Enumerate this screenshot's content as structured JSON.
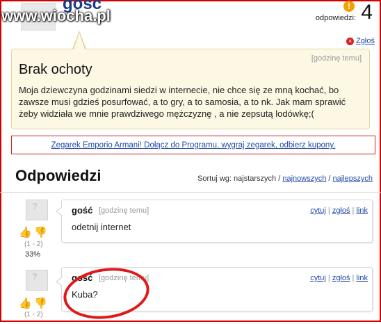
{
  "watermark": "www.wiocha.pl",
  "question": {
    "author": "gość",
    "answers_label": "odpowiedzi:",
    "answers_count": "4",
    "badge": "!",
    "report_label": "Zgłoś",
    "time": "[godzinę temu]",
    "title": "Brak ochoty",
    "body": "Moja dziewczyna godzinami siedzi w internecie, nie chce się ze mną kochać, bo zawsze musi gdzieś posurfować, a to gry, a to samosia, a to nk. Jak mam sprawić żeby widziała we mnie prawdziwego mężczyznę , a nie zepsutą lodówkę;("
  },
  "promo": {
    "text": "Zegarek Emporio Armani! Dołącz do Programu, wygraj zegarek, odbierz kupony."
  },
  "answers_section": {
    "title": "Odpowiedzi",
    "sort_label": "Sortuj wg: najstarszych /",
    "sort_newest": "najnowszych",
    "sort_sep": "/",
    "sort_best": "najlepszych"
  },
  "answers": [
    {
      "author": "gość",
      "time": "[godzinę temu]",
      "text": "odetnij internet",
      "score": "(1 - 2)",
      "percent": "33%",
      "actions": {
        "quote": "cytuj",
        "report": "zgłoś",
        "link": "link"
      }
    },
    {
      "author": "gość",
      "time": "[godzinę temu]",
      "text": "Kuba?",
      "score": "(1 - 2)",
      "actions": {
        "quote": "cytuj",
        "report": "zgłoś",
        "link": "link"
      }
    }
  ],
  "icons": {
    "thumb_up": "thumb-up-icon",
    "thumb_down": "thumb-down-icon",
    "report": "report-x-icon",
    "avatar": "avatar-placeholder"
  },
  "colors": {
    "question_bg": "#fdf8e4",
    "link": "#224aa8",
    "highlight": "#e01818"
  }
}
